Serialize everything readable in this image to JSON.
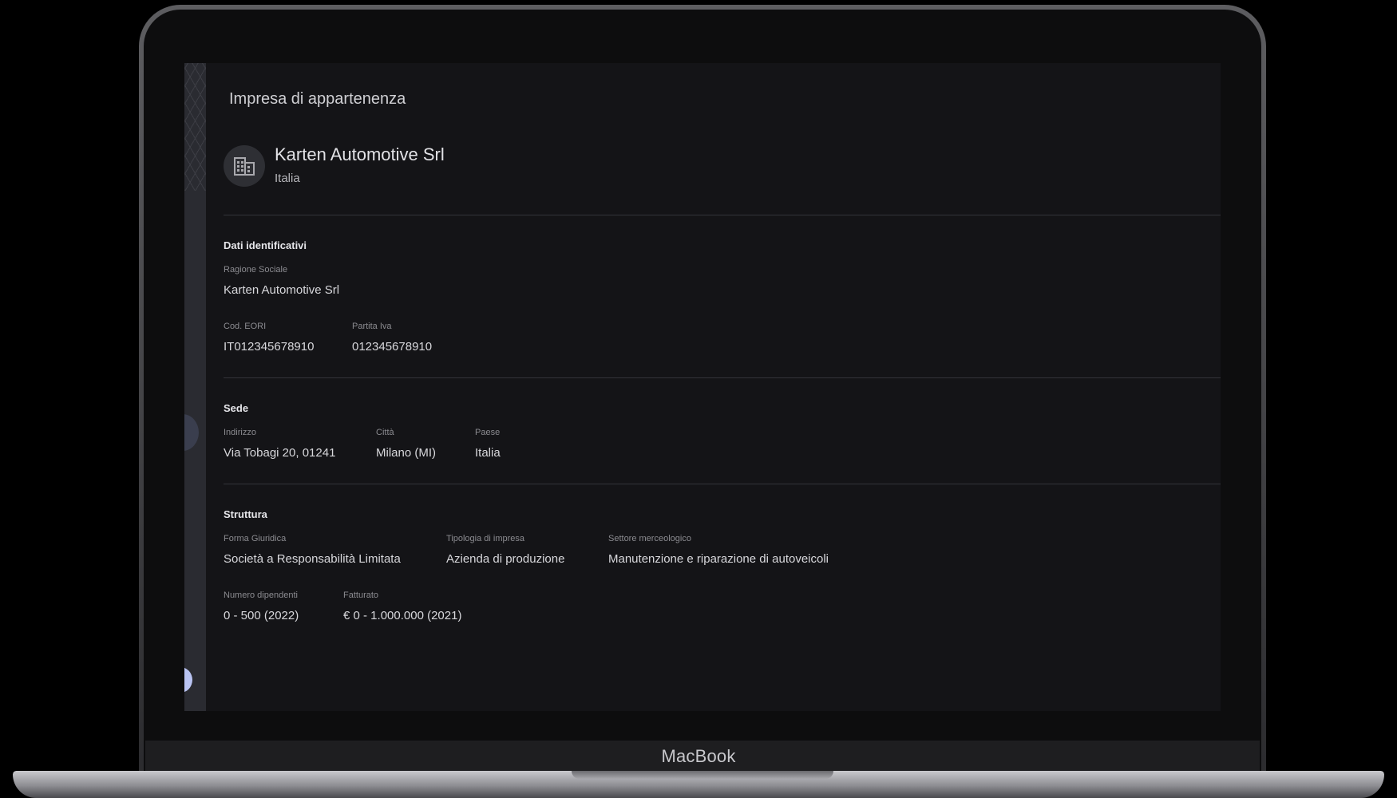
{
  "device": {
    "brand_label": "MacBook"
  },
  "panel": {
    "title": "Impresa di appartenenza",
    "company": {
      "name": "Karten Automotive Srl",
      "country": "Italia",
      "icon": "building-icon"
    }
  },
  "sections": {
    "identificativi": {
      "title": "Dati identificativi",
      "ragione_sociale": {
        "label": "Ragione Sociale",
        "value": "Karten Automotive Srl"
      },
      "eori": {
        "label": "Cod. EORI",
        "value": "IT012345678910"
      },
      "piva": {
        "label": "Partita Iva",
        "value": "012345678910"
      }
    },
    "sede": {
      "title": "Sede",
      "indirizzo": {
        "label": "Indirizzo",
        "value": "Via Tobagi 20, 01241"
      },
      "citta": {
        "label": "Città",
        "value": "Milano (MI)"
      },
      "paese": {
        "label": "Paese",
        "value": "Italia"
      }
    },
    "struttura": {
      "title": "Struttura",
      "forma": {
        "label": "Forma Giuridica",
        "value": "Società a Responsabilità Limitata"
      },
      "tipologia": {
        "label": "Tipologia di impresa",
        "value": "Azienda di produzione"
      },
      "settore": {
        "label": "Settore merceologico",
        "value": "Manutenzione e riparazione di autoveicoli"
      },
      "dipendenti": {
        "label": "Numero dipendenti",
        "value": "0 - 500 (2022)"
      },
      "fatturato": {
        "label": "Fatturato",
        "value": "€ 0 - 1.000.000 (2021)"
      }
    }
  }
}
